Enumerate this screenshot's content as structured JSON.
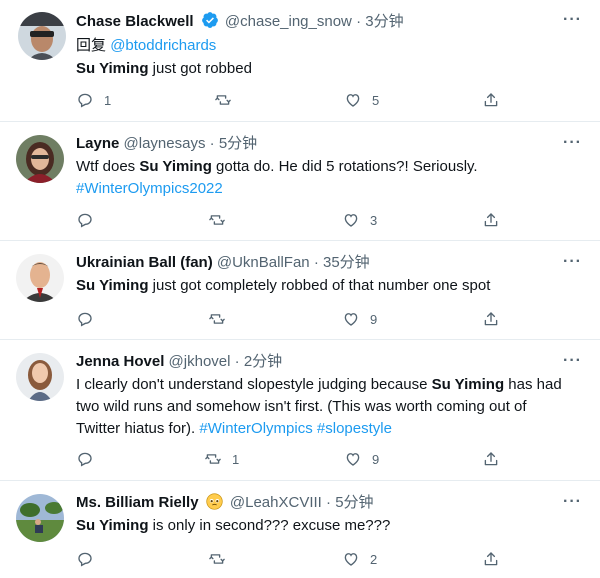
{
  "tweets": [
    {
      "name": "Chase Blackwell",
      "handle": "@chase_ing_snow",
      "dot": "·",
      "time": "3分钟",
      "reply_prefix": "回复",
      "reply_to": "@btoddrichards",
      "text_bold": "Su Yiming",
      "text_rest": " just got robbed",
      "counts": {
        "reply": "1",
        "retweet": "",
        "like": "5"
      }
    },
    {
      "name": "Layne",
      "handle": "@laynesays",
      "dot": "·",
      "time": "5分钟",
      "text_pre": "Wtf does ",
      "text_bold": "Su Yiming",
      "text_rest": " gotta do. He did 5 rotations?! Seriously.",
      "hashtag": "#WinterOlympics2022",
      "counts": {
        "reply": "",
        "retweet": "",
        "like": "3"
      }
    },
    {
      "name": "Ukrainian Ball (fan)",
      "handle": "@UknBallFan",
      "dot": "·",
      "time": "35分钟",
      "text_bold": "Su Yiming",
      "text_rest": " just got completely robbed of that number one spot",
      "counts": {
        "reply": "",
        "retweet": "",
        "like": "9"
      }
    },
    {
      "name": "Jenna Hovel",
      "handle": "@jkhovel",
      "dot": "·",
      "time": "2分钟",
      "text_line1_pre": "I clearly don't understand slopestyle judging because ",
      "text_bold": "Su Yiming",
      "text_line1_post": " has had",
      "text_line2": "two wild runs and somehow isn't first. (This was worth coming out of",
      "text_line3_pre": "Twitter hiatus for). ",
      "hashtag1": "#WinterOlympics",
      "hashtag2": "#slopestyle",
      "counts": {
        "reply": "",
        "retweet": "1",
        "like": "9"
      }
    },
    {
      "name": "Ms. Billiam Rielly",
      "handle": "@LeahXCVIII",
      "dot": "·",
      "time": "5分钟",
      "text_bold": "Su Yiming",
      "text_rest": " is only in second??? excuse me???",
      "counts": {
        "reply": "",
        "retweet": "",
        "like": "2"
      }
    }
  ],
  "more_label": "···",
  "colors": {
    "link": "#1d9bf0",
    "muted": "#536471",
    "divider": "#e6ecf0",
    "verified": "#1d9bf0"
  }
}
